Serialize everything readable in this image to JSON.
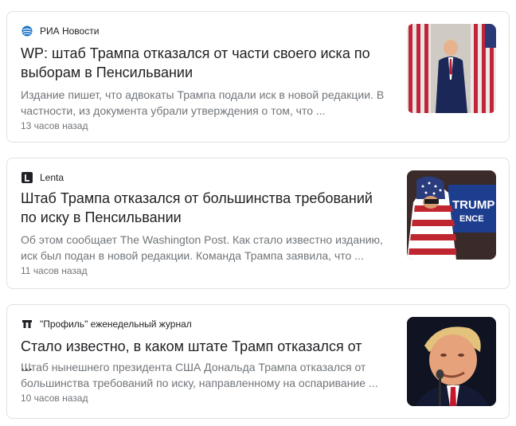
{
  "articles": [
    {
      "source": "РИА Новости",
      "source_icon": "ria-globe-icon",
      "title": "WP: штаб Трампа отказался от части своего иска по выборам в Пенсильвании",
      "snippet": "Издание пишет, что адвокаты Трампа подали иск в новой редакции. В частности, из документа убрали утверждения о том, что ...",
      "time": "13 часов назад",
      "image": "trump-walking-flags-photo"
    },
    {
      "source": "Lenta",
      "source_icon": "lenta-l-icon",
      "title": "Штаб Трампа отказался от большинства требований по иску в Пенсильвании",
      "snippet": "Об этом сообщает The Washington Post. Как стало известно изданию, иск был подан в новой редакции. Команда Трампа заявила, что ...",
      "time": "11 часов назад",
      "image": "supporter-flag-rally-photo",
      "image_sign_text": [
        "TRUMP",
        "ENCE"
      ]
    },
    {
      "source": "\"Профиль\" еженедельный журнал",
      "source_icon": "profil-p-icon",
      "title": "Стало известно, в каком штате Трамп отказался от ...",
      "snippet": "Штаб нынешнего президента США Дональда Трампа отказался от большинства требований по иску, направленному на оспаривание ...",
      "time": "10 часов назад",
      "image": "trump-speaking-microphone-photo"
    }
  ],
  "colors": {
    "border": "#dfe1e5",
    "title": "#202124",
    "secondary": "#70757a",
    "ria_blue": "#1a73c9"
  }
}
